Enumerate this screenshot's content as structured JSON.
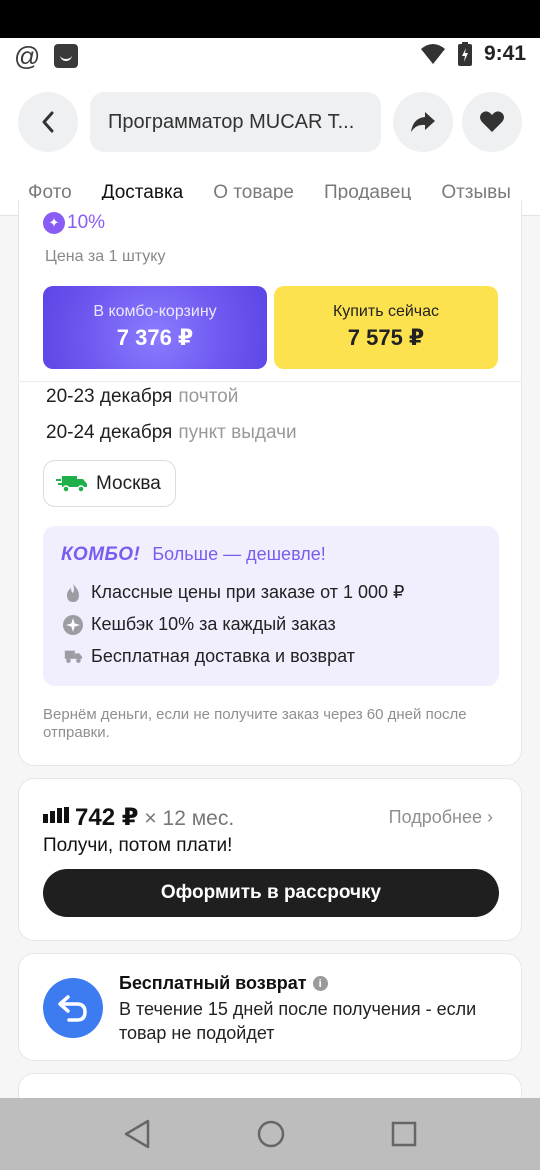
{
  "status_bar": {
    "time": "9:41",
    "left_icons": [
      "at-icon",
      "bag-icon"
    ],
    "right_icons": [
      "wifi-icon",
      "battery-icon"
    ],
    "at_glyph": "@"
  },
  "header": {
    "search_text": "Программатор MUCAR T...",
    "icons": [
      "back-icon",
      "share-icon",
      "heart-icon"
    ]
  },
  "tabs": [
    {
      "label": "Фото",
      "active": false
    },
    {
      "label": "Доставка",
      "active": true
    },
    {
      "label": "О товаре",
      "active": false
    },
    {
      "label": "Продавец",
      "active": false
    },
    {
      "label": "Отзывы",
      "active": false
    }
  ],
  "price_card": {
    "cashback_badge": "10%",
    "per_unit_label": "Цена за 1 штуку",
    "combo_button": {
      "label": "В комбо-корзину",
      "price": "7 376 ₽"
    },
    "buy_button": {
      "label": "Купить сейчас",
      "price": "7 575 ₽"
    },
    "delivery": [
      {
        "dates": "20-23 декабря",
        "mode": "почтой"
      },
      {
        "dates": "20-24 декабря",
        "mode": "пункт выдачи"
      }
    ],
    "city": "Москва",
    "combo": {
      "logo": "КОМБО!",
      "tagline": "Больше — дешевле!",
      "items": [
        {
          "icon": "flame-icon",
          "text": "Классные цены при заказе от 1 000 ₽"
        },
        {
          "icon": "cashback-star-icon",
          "text": "Кешбэк 10% за каждый заказ"
        },
        {
          "icon": "truck-icon",
          "text": "Бесплатная доставка и возврат"
        }
      ]
    },
    "refund_note": "Вернём деньги, если не получите заказ через 60 дней после отправки."
  },
  "installment": {
    "price": "742 ₽",
    "period": "× 12 мес.",
    "more": "Подробнее ›",
    "subtitle": "Получи, потом плати!",
    "button": "Оформить в рассрочку"
  },
  "free_return": {
    "title": "Бесплатный возврат",
    "description": "В течение 15 дней после получения - если товар не подойдет"
  },
  "colors": {
    "accent_purple": "#7b5cf0",
    "combo_button": "#6e59f0",
    "buy_button": "#fde24f",
    "return_blue": "#3c7cf0",
    "delivery_truck": "#1fb04a"
  }
}
